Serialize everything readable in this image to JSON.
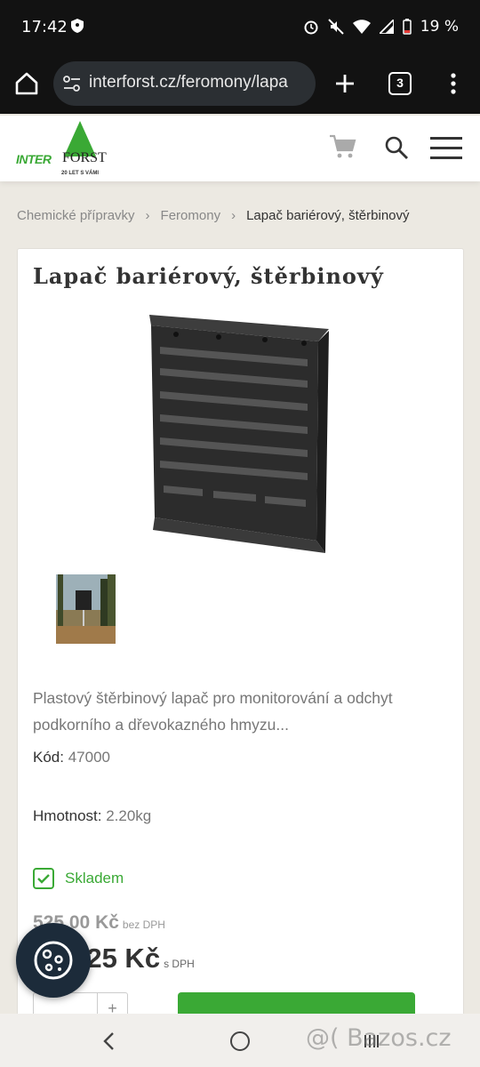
{
  "status_bar": {
    "time": "17:42",
    "battery": "19 %"
  },
  "browser": {
    "url": "interforst.cz/feromony/lapa",
    "tab_count": "3"
  },
  "site": {
    "logo_inter": "INTER",
    "logo_forst": "FORST",
    "logo_sub": "20 LET S VÁMI"
  },
  "breadcrumb": [
    {
      "label": "Chemické přípravky"
    },
    {
      "label": "Feromony"
    },
    {
      "label": "Lapač bariérový, štěrbinový"
    }
  ],
  "product": {
    "title": "Lapač bariérový, štěrbinový",
    "description": "Plastový štěrbinový lapač pro monitorování a odchyt podkorního a dřevokazného hmyzu...",
    "code_label": "Kód:",
    "code_value": "47000",
    "weight_label": "Hmotnost:",
    "weight_value": "2.20kg",
    "stock": "Skladem",
    "price_net": "525,00 Kč",
    "price_net_label": "bez DPH",
    "price_gross": "635,25 Kč",
    "price_gross_label": "s DPH",
    "qty_plus": "+"
  },
  "watermark": "@( Bazos.cz",
  "colors": {
    "brand_green": "#3aa935",
    "header_dark": "#121212",
    "fab": "#1c2b3a"
  }
}
